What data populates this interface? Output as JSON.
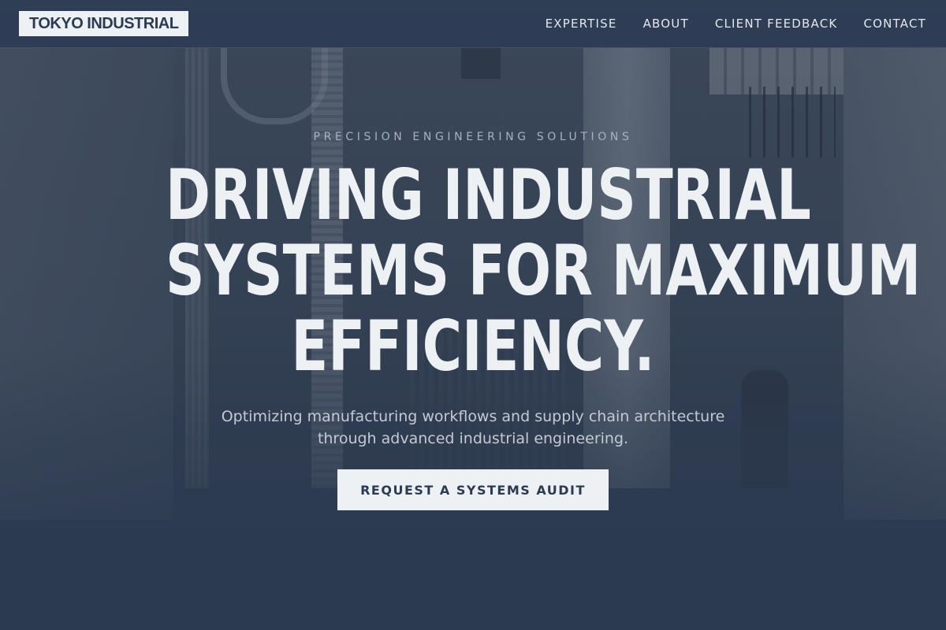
{
  "header": {
    "logo_text": "TOKYO INDUSTRIAL",
    "nav": [
      {
        "label": "EXPERTISE"
      },
      {
        "label": "ABOUT"
      },
      {
        "label": "CLIENT FEEDBACK"
      },
      {
        "label": "CONTACT"
      }
    ]
  },
  "hero": {
    "eyebrow": "PRECISION ENGINEERING SOLUTIONS",
    "headline_lines": [
      "DRIVING INDUSTRIAL",
      "SYSTEMS FOR MAXIMUM",
      "EFFICIENCY."
    ],
    "subcopy_lines": [
      "Optimizing manufacturing workflows and supply chain architecture",
      "through advanced industrial engineering."
    ],
    "cta_label": "REQUEST A SYSTEMS AUDIT"
  },
  "colors": {
    "header_bg": "#2c3c54",
    "page_bg": "#2c3a4f",
    "headline": "#eef1f4",
    "button_bg": "#eef1f4",
    "button_text": "#2b3b52"
  }
}
